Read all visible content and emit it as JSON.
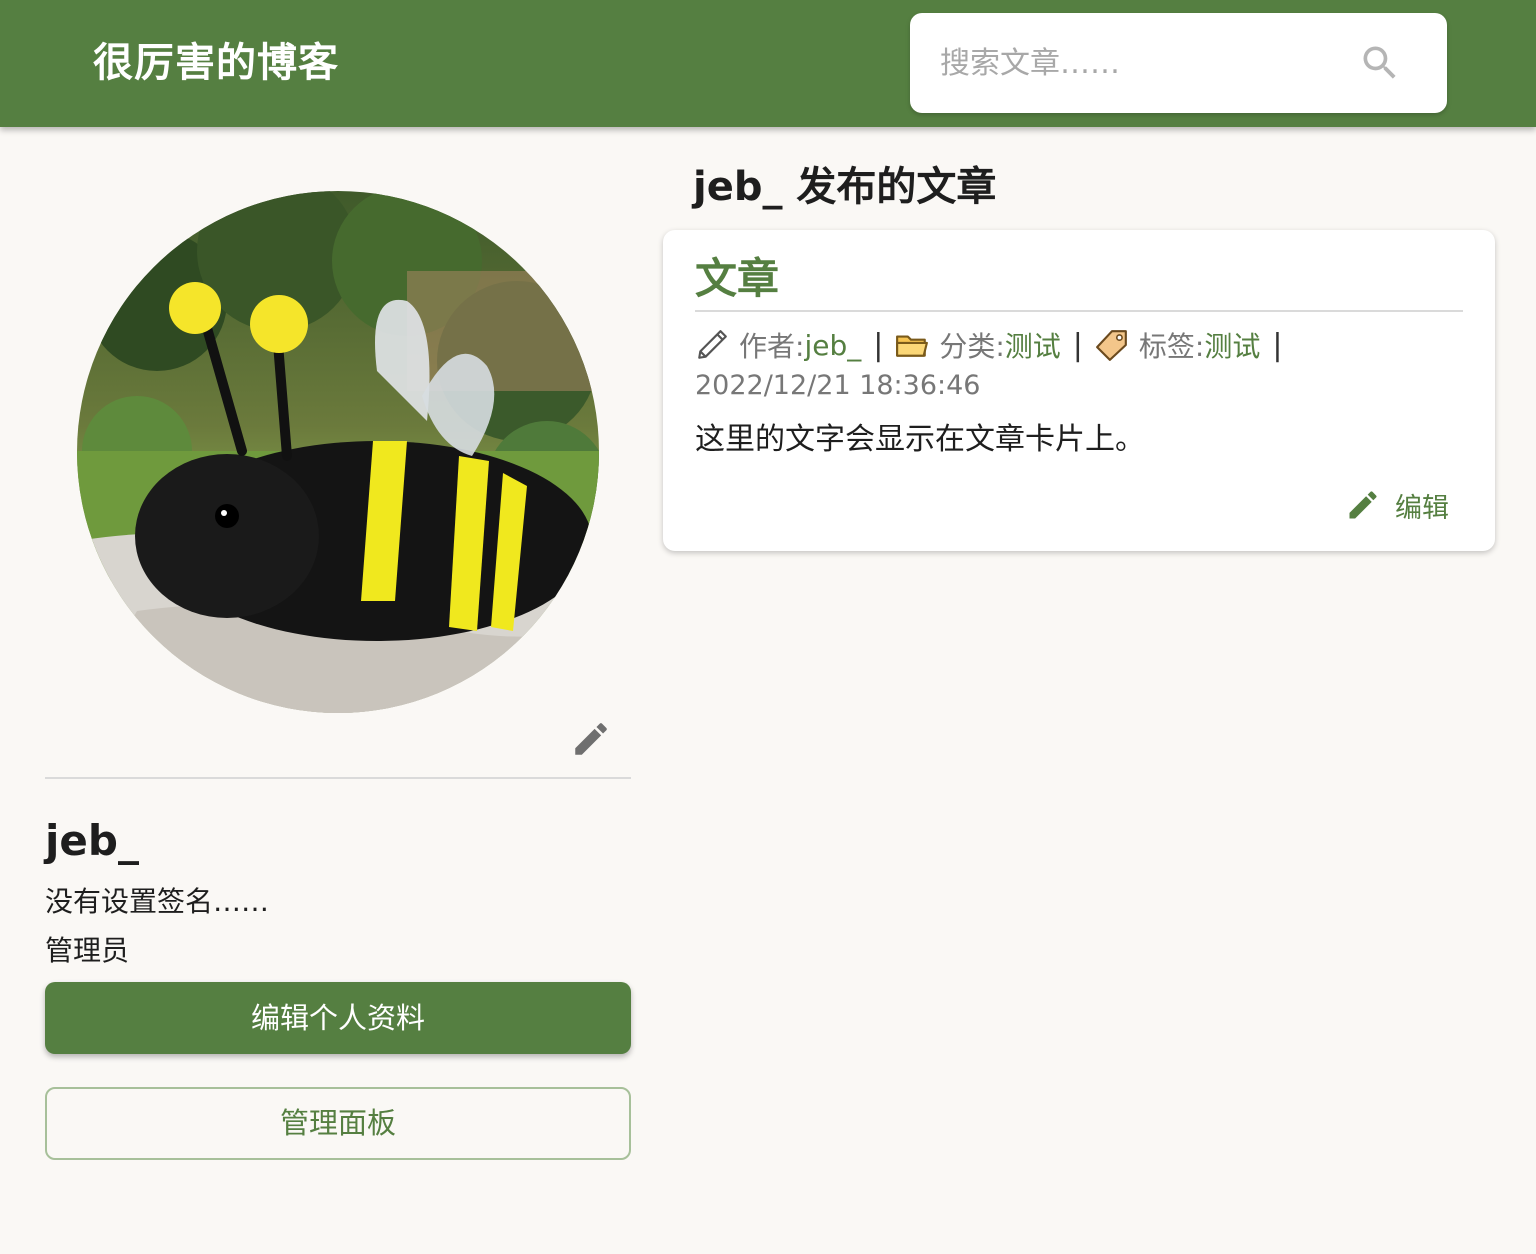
{
  "header": {
    "site_title": "很厉害的博客",
    "search_placeholder": "搜索文章……",
    "search_icon": "search-icon"
  },
  "profile": {
    "avatar_alt": "avatar",
    "username": "jeb_",
    "signature": "没有设置签名……",
    "role": "管理员",
    "edit_profile_label": "编辑个人资料",
    "admin_panel_label": "管理面板"
  },
  "posts_section": {
    "heading": "jeb_ 发布的文章",
    "posts": [
      {
        "title": "文章",
        "author_label": "作者: ",
        "author": "jeb_",
        "category_label": "分类: ",
        "category": "测试",
        "tag_label": "标签: ",
        "tag": "测试",
        "separator": "|",
        "date": "2022/12/21 18:36:46",
        "excerpt": "这里的文字会显示在文章卡片上。",
        "edit_label": "编辑"
      }
    ]
  },
  "colors": {
    "primary": "#557f41",
    "background": "#faf8f5",
    "card": "#ffffff",
    "muted_text": "#777777"
  }
}
